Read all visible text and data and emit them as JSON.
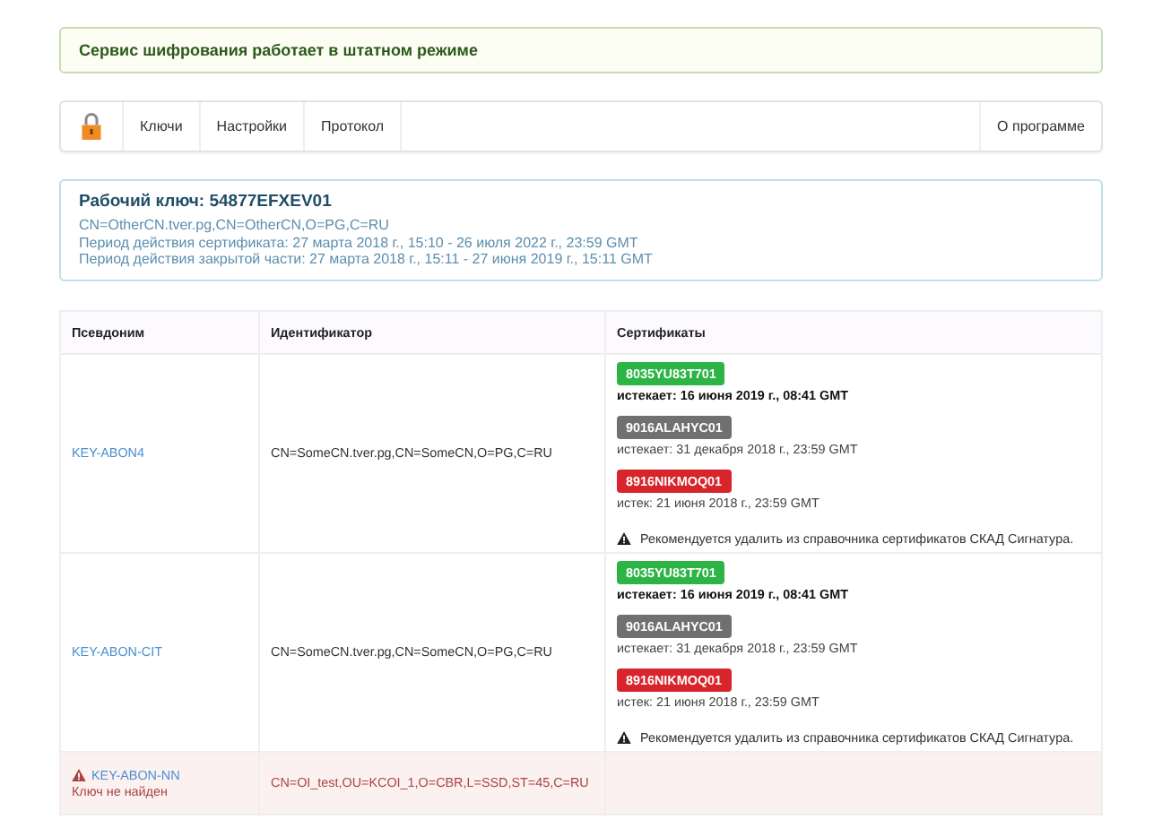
{
  "alert": {
    "text": "Сервис шифрования работает в штатном режиме"
  },
  "navbar": {
    "items": [
      {
        "label": "Ключи"
      },
      {
        "label": "Настройки"
      },
      {
        "label": "Протокол"
      }
    ],
    "right_items": [
      {
        "label": "О программе"
      }
    ]
  },
  "key_panel": {
    "title": "Рабочий ключ: 54877EFXEV01",
    "lines": [
      "CN=OtherCN.tver.pg,CN=OtherCN,O=PG,C=RU",
      "Период действия сертификата: 27 марта 2018 г., 15:10 - 26 июля 2022 г., 23:59 GMT",
      "Период действия закрытой части: 27 марта 2018 г., 15:11 - 27 июня 2019 г., 15:11 GMT"
    ]
  },
  "table": {
    "columns": [
      "Псевдоним",
      "Идентификатор",
      "Сертификаты"
    ],
    "rows": [
      {
        "kind": "normal",
        "alias": "KEY-ABON4",
        "identifier": "CN=SomeCN.tver.pg,CN=SomeCN,O=PG,C=RU",
        "certificates": [
          {
            "kind": "valid",
            "label": "8035YU83T701",
            "expiry": "истекает: 16 июня 2019 г., 08:41 GMT"
          },
          {
            "kind": "pending",
            "label": "9016ALAHYC01",
            "expiry": "истекает: 31 декабря 2018 г., 23:59 GMT"
          },
          {
            "kind": "expired",
            "label": "8916NIKMOQ01",
            "expiry": "истек: 21 июня 2018 г., 23:59 GMT"
          }
        ],
        "warning": "Рекомендуется удалить из справочника сертификатов СКАД Сигнатура."
      },
      {
        "kind": "normal",
        "alias": "KEY-ABON-CIT",
        "identifier": "CN=SomeCN.tver.pg,CN=SomeCN,O=PG,C=RU",
        "certificates": [
          {
            "kind": "valid",
            "label": "8035YU83T701",
            "expiry": "истекает: 16 июня 2019 г., 08:41 GMT"
          },
          {
            "kind": "pending",
            "label": "9016ALAHYC01",
            "expiry": "истекает: 31 декабря 2018 г., 23:59 GMT"
          },
          {
            "kind": "expired",
            "label": "8916NIKMOQ01",
            "expiry": "истек: 21 июня 2018 г., 23:59 GMT"
          }
        ],
        "warning": "Рекомендуется удалить из справочника сертификатов СКАД Сигнатура."
      },
      {
        "kind": "error",
        "alias": "KEY-ABON-NN",
        "note": "Ключ не найден",
        "identifier": "CN=OI_test,OU=KCOI_1,O=CBR,L=SSD,ST=45,C=RU"
      }
    ]
  }
}
